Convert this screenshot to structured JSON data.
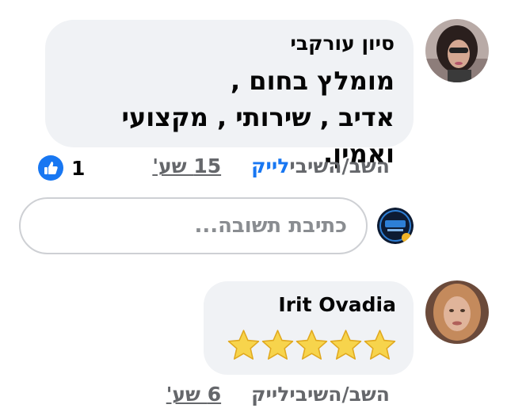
{
  "comments": [
    {
      "author": "סיון עורקבי",
      "lines": [
        "מומלץ בחום ,",
        "אדיב , שירותי , מקצועי ואמין."
      ],
      "time": "15 שע'",
      "like_label": "לייק",
      "reply_label": "השב/השיבי",
      "reaction_count": "1",
      "reaction_icon": "thumbs-up-icon"
    },
    {
      "author": "Irit Ovadia",
      "stars": 5,
      "time": "6 שע'",
      "like_label": "לייק",
      "reply_label": "השב/השיבי"
    }
  ],
  "reply_box": {
    "placeholder": "כתיבת תשובה..."
  },
  "colors": {
    "bubble": "#f0f2f5",
    "like_active": "#1877f2",
    "meta": "#65676b",
    "star": "#f7d44c"
  }
}
